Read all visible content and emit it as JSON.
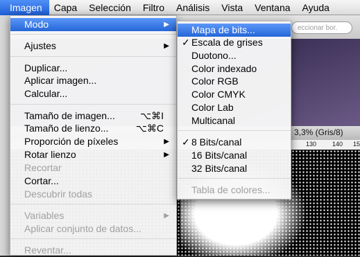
{
  "menubar": {
    "items": [
      "Imagen",
      "Capa",
      "Selección",
      "Filtro",
      "Análisis",
      "Vista",
      "Ventana",
      "Ayuda"
    ]
  },
  "background": {
    "search_placeholder": "eccionar bor.",
    "doc_title": "3,3% (Gris/8)",
    "ruler_labels": [
      "130",
      "140",
      "15"
    ]
  },
  "image_menu": {
    "modo": "Modo",
    "ajustes": "Ajustes",
    "duplicar": "Duplicar...",
    "aplicar_imagen": "Aplicar imagen...",
    "calcular": "Calcular...",
    "tamano_imagen": "Tamaño de imagen...",
    "tamano_imagen_shortcut": "⌥⌘I",
    "tamano_lienzo": "Tamaño de lienzo...",
    "tamano_lienzo_shortcut": "⌥⌘C",
    "proporcion_pixeles": "Proporción de píxeles",
    "rotar_lienzo": "Rotar lienzo",
    "recortar": "Recortar",
    "cortar": "Cortar...",
    "descubrir_todas": "Descubrir todas",
    "variables": "Variables",
    "aplicar_conjunto": "Aplicar conjunto de datos...",
    "reventar": "Reventar..."
  },
  "mode_submenu": {
    "mapa_bits": "Mapa de bits...",
    "escala_grises": "Escala de grises",
    "duotono": "Duotono...",
    "color_indexado": "Color indexado",
    "color_rgb": "Color RGB",
    "color_cmyk": "Color CMYK",
    "color_lab": "Color Lab",
    "multicanal": "Multicanal",
    "bits8": "8 Bits/canal",
    "bits16": "16 Bits/canal",
    "bits32": "32 Bits/canal",
    "tabla_colores": "Tabla de colores...",
    "checkmark": "✓"
  }
}
